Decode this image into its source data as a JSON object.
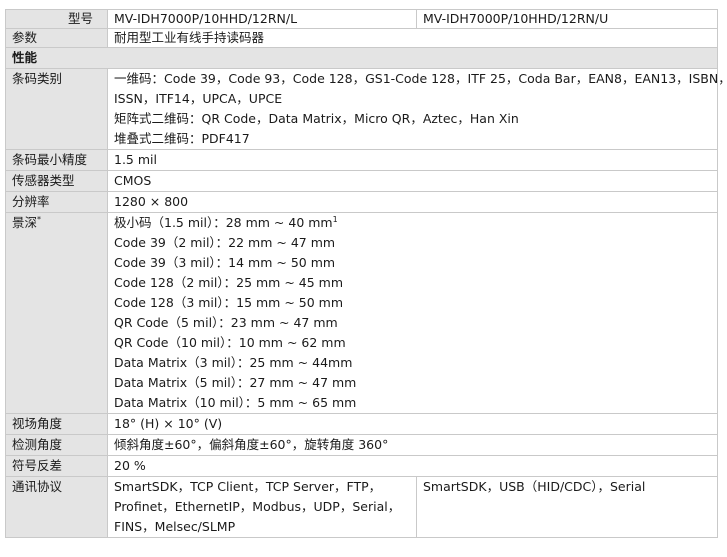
{
  "header": {
    "model_label": "型号",
    "params_label": "参数",
    "models": [
      "MV-IDH7000P/10HHD/12RN/L",
      "MV-IDH7000P/10HHD/12RN/U"
    ],
    "product_desc": "耐用型工业有线手持读码器"
  },
  "section_performance": "性能",
  "rows": {
    "barcode_types": {
      "label": "条码类别",
      "lines": [
        "一维码：Code 39，Code 93，Code 128，GS1-Code 128，ITF 25，Coda Bar，EAN8，EAN13，ISBN，",
        "ISSN，ITF14，UPCA，UPCE",
        "矩阵式二维码：QR Code，Data Matrix，Micro QR，Aztec，Han Xin",
        "堆叠式二维码：PDF417"
      ]
    },
    "min_precision": {
      "label": "条码最小精度",
      "value": "1.5 mil"
    },
    "sensor_type": {
      "label": "传感器类型",
      "value": "CMOS"
    },
    "resolution": {
      "label": "分辨率",
      "value": "1280 × 800"
    },
    "depth_of_field": {
      "label": "景深",
      "label_sup": "*",
      "lines": [
        "极小码（1.5 mil）：28 mm ~ 40 mm",
        "Code 39（2 mil）：22 mm ~ 47 mm",
        "Code 39（3 mil）：14 mm ~ 50 mm",
        "Code 128（2 mil）：25 mm ~ 45 mm",
        "Code 128（3 mil）：15 mm ~ 50 mm",
        "QR Code（5 mil）：23 mm ~ 47 mm",
        "QR Code（10 mil）：10 mm ~ 62 mm",
        "Data Matrix（3 mil）：25 mm ~ 44mm",
        "Data Matrix（5 mil）：27 mm ~ 47 mm",
        "Data Matrix（10 mil）：5 mm ~ 65 mm"
      ],
      "first_line_sup": "1"
    },
    "field_of_view": {
      "label": "视场角度",
      "value": "18° (H) × 10° (V)"
    },
    "detection_angle": {
      "label": "检测角度",
      "value": "倾斜角度±60°，偏斜角度±60°，旋转角度 360°"
    },
    "symbol_contrast": {
      "label": "符号反差",
      "value": "20 %"
    },
    "protocols": {
      "label": "通讯协议",
      "left_lines": [
        "SmartSDK，TCP Client，TCP Server，FTP，",
        "Profinet，EthernetIP，Modbus，UDP，Serial，",
        "FINS，Melsec/SLMP"
      ],
      "right_value": "SmartSDK，USB（HID/CDC），Serial"
    }
  }
}
